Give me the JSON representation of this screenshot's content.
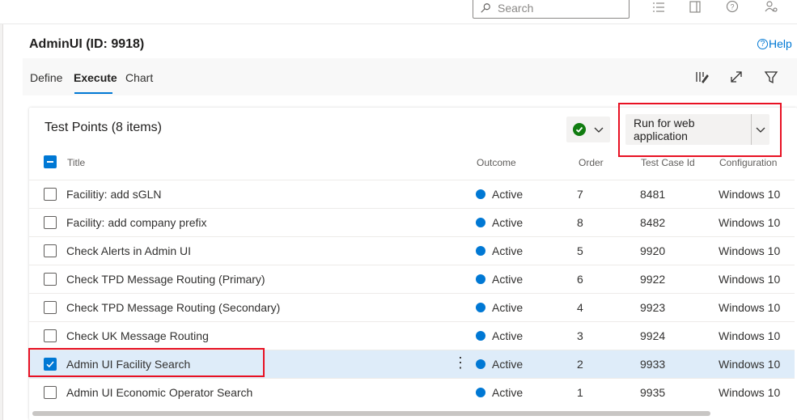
{
  "search": {
    "placeholder": "Search"
  },
  "page": {
    "title": "AdminUI (ID: 9918)",
    "help_label": "Help"
  },
  "tabs": [
    {
      "label": "Define"
    },
    {
      "label": "Execute",
      "active": true
    },
    {
      "label": "Chart"
    }
  ],
  "card": {
    "title": "Test Points (8 items)",
    "run_button_label": "Run for web application"
  },
  "columns": {
    "title": "Title",
    "outcome": "Outcome",
    "order": "Order",
    "test_case_id": "Test Case Id",
    "configuration": "Configuration"
  },
  "rows": [
    {
      "title": "Facilitiy: add sGLN",
      "outcome": "Active",
      "order": "7",
      "test_case_id": "8481",
      "configuration": "Windows 10",
      "checked": false
    },
    {
      "title": "Facility: add company prefix",
      "outcome": "Active",
      "order": "8",
      "test_case_id": "8482",
      "configuration": "Windows 10",
      "checked": false
    },
    {
      "title": "Check Alerts in Admin UI",
      "outcome": "Active",
      "order": "5",
      "test_case_id": "9920",
      "configuration": "Windows 10",
      "checked": false
    },
    {
      "title": "Check TPD Message Routing (Primary)",
      "outcome": "Active",
      "order": "6",
      "test_case_id": "9922",
      "configuration": "Windows 10",
      "checked": false
    },
    {
      "title": "Check TPD Message Routing (Secondary)",
      "outcome": "Active",
      "order": "4",
      "test_case_id": "9923",
      "configuration": "Windows 10",
      "checked": false
    },
    {
      "title": "Check UK Message Routing",
      "outcome": "Active",
      "order": "3",
      "test_case_id": "9924",
      "configuration": "Windows 10",
      "checked": false
    },
    {
      "title": "Admin UI Facility Search",
      "outcome": "Active",
      "order": "2",
      "test_case_id": "9933",
      "configuration": "Windows 10",
      "checked": true
    },
    {
      "title": "Admin UI Economic Operator Search",
      "outcome": "Active",
      "order": "1",
      "test_case_id": "9935",
      "configuration": "Windows 10",
      "checked": false
    }
  ],
  "colors": {
    "accent": "#0078d4",
    "active_dot": "#0078d4",
    "passed_green": "#107c10",
    "highlight_red": "#e81123",
    "selected_row": "#deecf9"
  },
  "icons": [
    "search-icon",
    "list-icon",
    "panel-icon",
    "help-circle-icon",
    "person-settings-icon",
    "column-options-icon",
    "expand-icon",
    "filter-icon",
    "check-circle-icon",
    "chevron-down-icon",
    "more-vertical-icon"
  ]
}
